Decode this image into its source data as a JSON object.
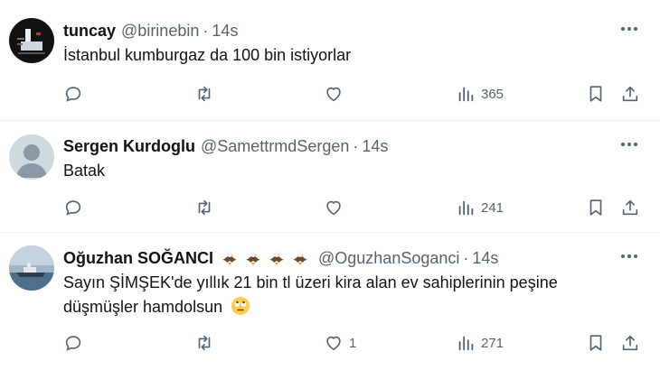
{
  "tweets": [
    {
      "name": "tuncay",
      "handle": "@birinebin",
      "dot": "·",
      "time": "14s",
      "text": "İstanbul kumburgaz da 100 bin istiyorlar",
      "reply_count": "",
      "retweet_count": "",
      "like_count": "",
      "view_count": "365",
      "avatar": "dark-photo-avatar"
    },
    {
      "name": "Sergen Kurdoglu",
      "handle": "@SamettrmdSergen",
      "dot": "·",
      "time": "14s",
      "text": "Batak",
      "reply_count": "",
      "retweet_count": "",
      "like_count": "",
      "view_count": "241",
      "avatar": "default-silhouette-avatar"
    },
    {
      "name": "Oğuzhan SOĞANCI",
      "badges": [
        "eagle-emoji",
        "eagle-emoji",
        "eagle-emoji",
        "eagle-emoji"
      ],
      "handle": "@OguzhanSoganci",
      "dot": "·",
      "time": "14s",
      "text": "Sayın ŞİMŞEK'de yıllık 21 bin tl üzeri kira alan ev sahiplerinin peşine düşmüşler hamdolsun",
      "emoji": "face-with-rolling-eyes",
      "reply_count": "",
      "retweet_count": "",
      "like_count": "1",
      "view_count": "271",
      "avatar": "ship-photo-avatar"
    }
  ],
  "colors": {
    "text_primary": "#0f1419",
    "text_secondary": "#536471",
    "divider": "#eff3f4"
  }
}
